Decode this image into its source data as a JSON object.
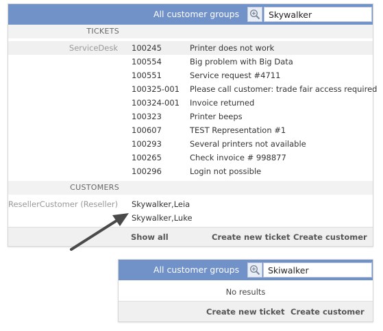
{
  "panel_top": {
    "header_title": "All customer groups",
    "search_value": "Skywalker",
    "tickets_section_label": "TICKETS",
    "ticket_group_label": "ServiceDesk",
    "tickets": [
      {
        "id": "100245",
        "title": "Printer does not work"
      },
      {
        "id": "100554",
        "title": "Big problem with Big Data"
      },
      {
        "id": "100551",
        "title": "Service request #4711"
      },
      {
        "id": "100325-001",
        "title": "Please call customer: trade fair access required"
      },
      {
        "id": "100324-001",
        "title": "Invoice returned"
      },
      {
        "id": "100323",
        "title": "Printer beeps"
      },
      {
        "id": "100607",
        "title": "TEST Representation #1"
      },
      {
        "id": "100293",
        "title": "Several printers not available"
      },
      {
        "id": "100265",
        "title": "Check invoice # 998877"
      },
      {
        "id": "100296",
        "title": "Login not possible"
      }
    ],
    "customers_section_label": "CUSTOMERS",
    "customer_group_label": "ResellerCustomer (Reseller)",
    "customers": [
      "Skywalker,Leia",
      "Skywalker,Luke"
    ],
    "footer": {
      "show_all": "Show all",
      "create_ticket": "Create new ticket",
      "create_customer": "Create customer"
    }
  },
  "panel_bottom": {
    "header_title": "All customer groups",
    "search_value": "Skiwalker",
    "no_results": "No results",
    "footer": {
      "create_ticket": "Create new ticket",
      "create_customer": "Create customer"
    }
  },
  "colors": {
    "header_bg": "#7191c9",
    "arrow": "#4a4a4a"
  },
  "icons": {
    "search": "magnifier-plus-icon",
    "annotation": "arrow-icon"
  }
}
